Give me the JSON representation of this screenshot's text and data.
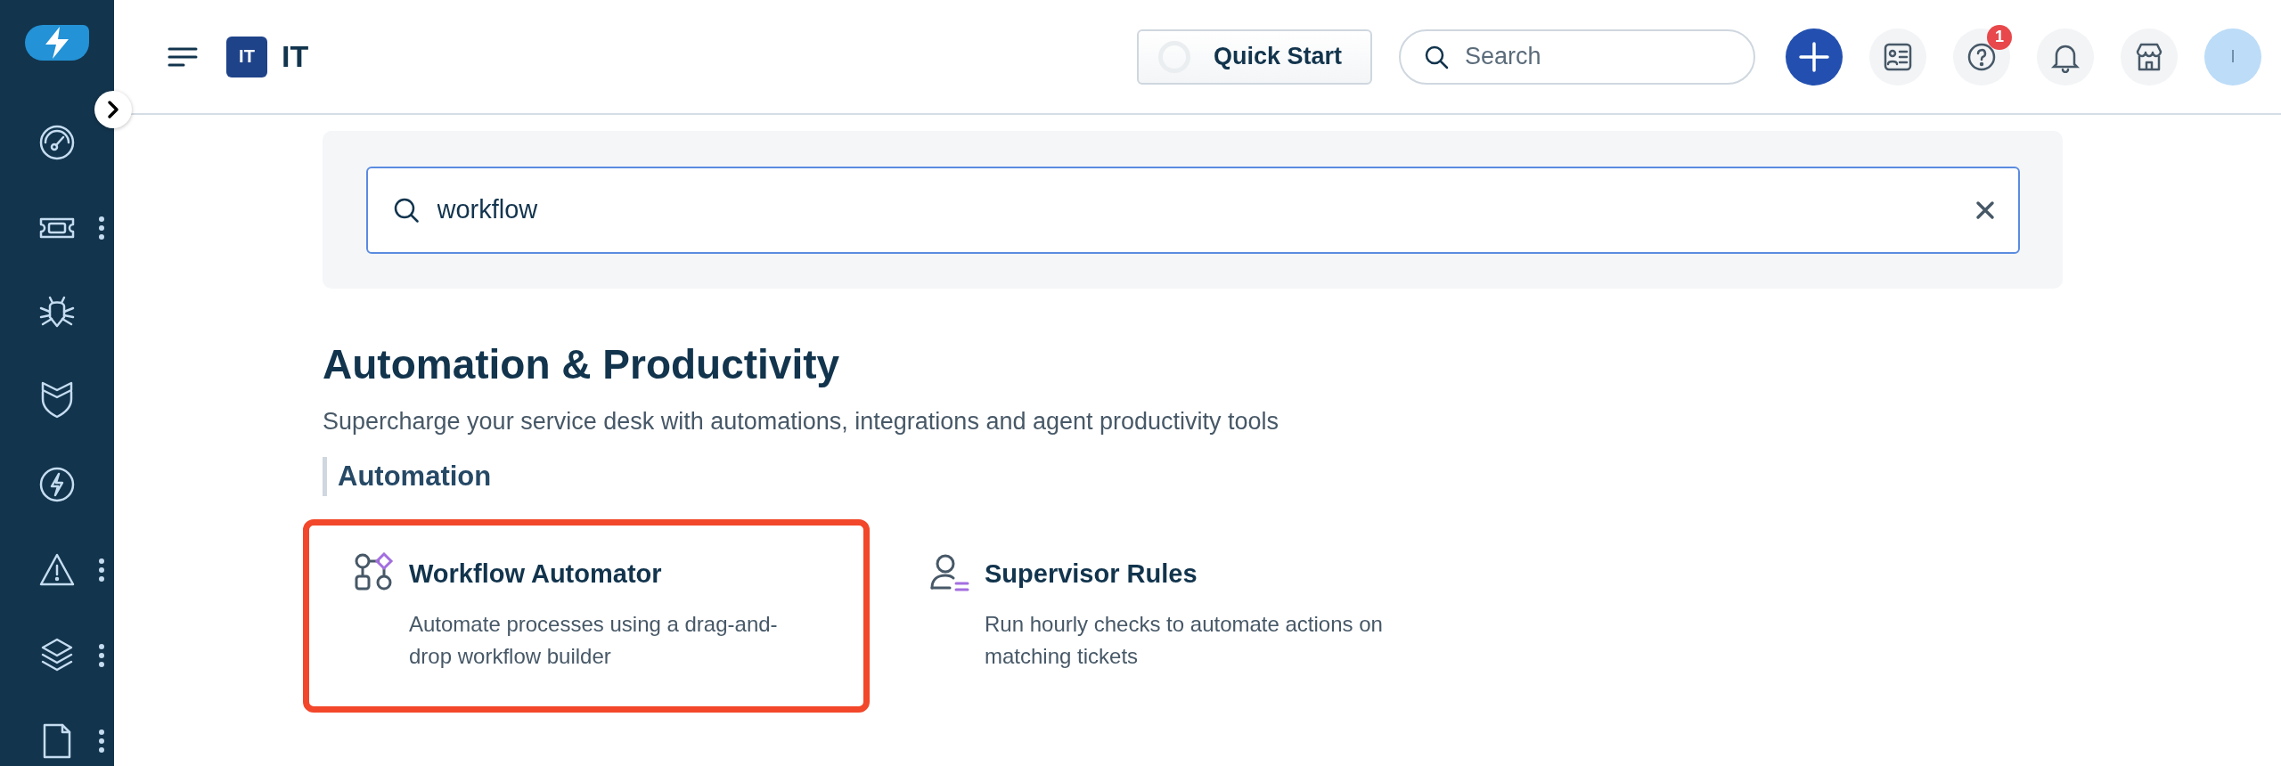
{
  "sidebar": {
    "items": [
      {
        "kind": "dashboard",
        "has_menu": false
      },
      {
        "kind": "ticket",
        "has_menu": true
      },
      {
        "kind": "bug",
        "has_menu": false
      },
      {
        "kind": "shield",
        "has_menu": false
      },
      {
        "kind": "bolt",
        "has_menu": false
      },
      {
        "kind": "alert",
        "has_menu": true
      },
      {
        "kind": "layers",
        "has_menu": true
      },
      {
        "kind": "document",
        "has_menu": true
      }
    ]
  },
  "header": {
    "workspace_badge": "IT",
    "workspace_name": "IT",
    "quick_start": "Quick Start",
    "search": {
      "placeholder": "Search"
    },
    "help_badge": "1",
    "avatar_initial": "I"
  },
  "search_panel": {
    "value": "workflow"
  },
  "section": {
    "title": "Automation & Productivity",
    "subtitle": "Supercharge your service desk with automations, integrations and agent productivity tools",
    "group": "Automation",
    "cards": [
      {
        "kind": "workflow",
        "title": "Workflow Automator",
        "description": "Automate processes using a drag-and-drop workflow builder",
        "highlighted": true
      },
      {
        "kind": "supervisor",
        "title": "Supervisor Rules",
        "description": "Run hourly checks to automate actions on matching tickets",
        "highlighted": false
      }
    ]
  }
}
